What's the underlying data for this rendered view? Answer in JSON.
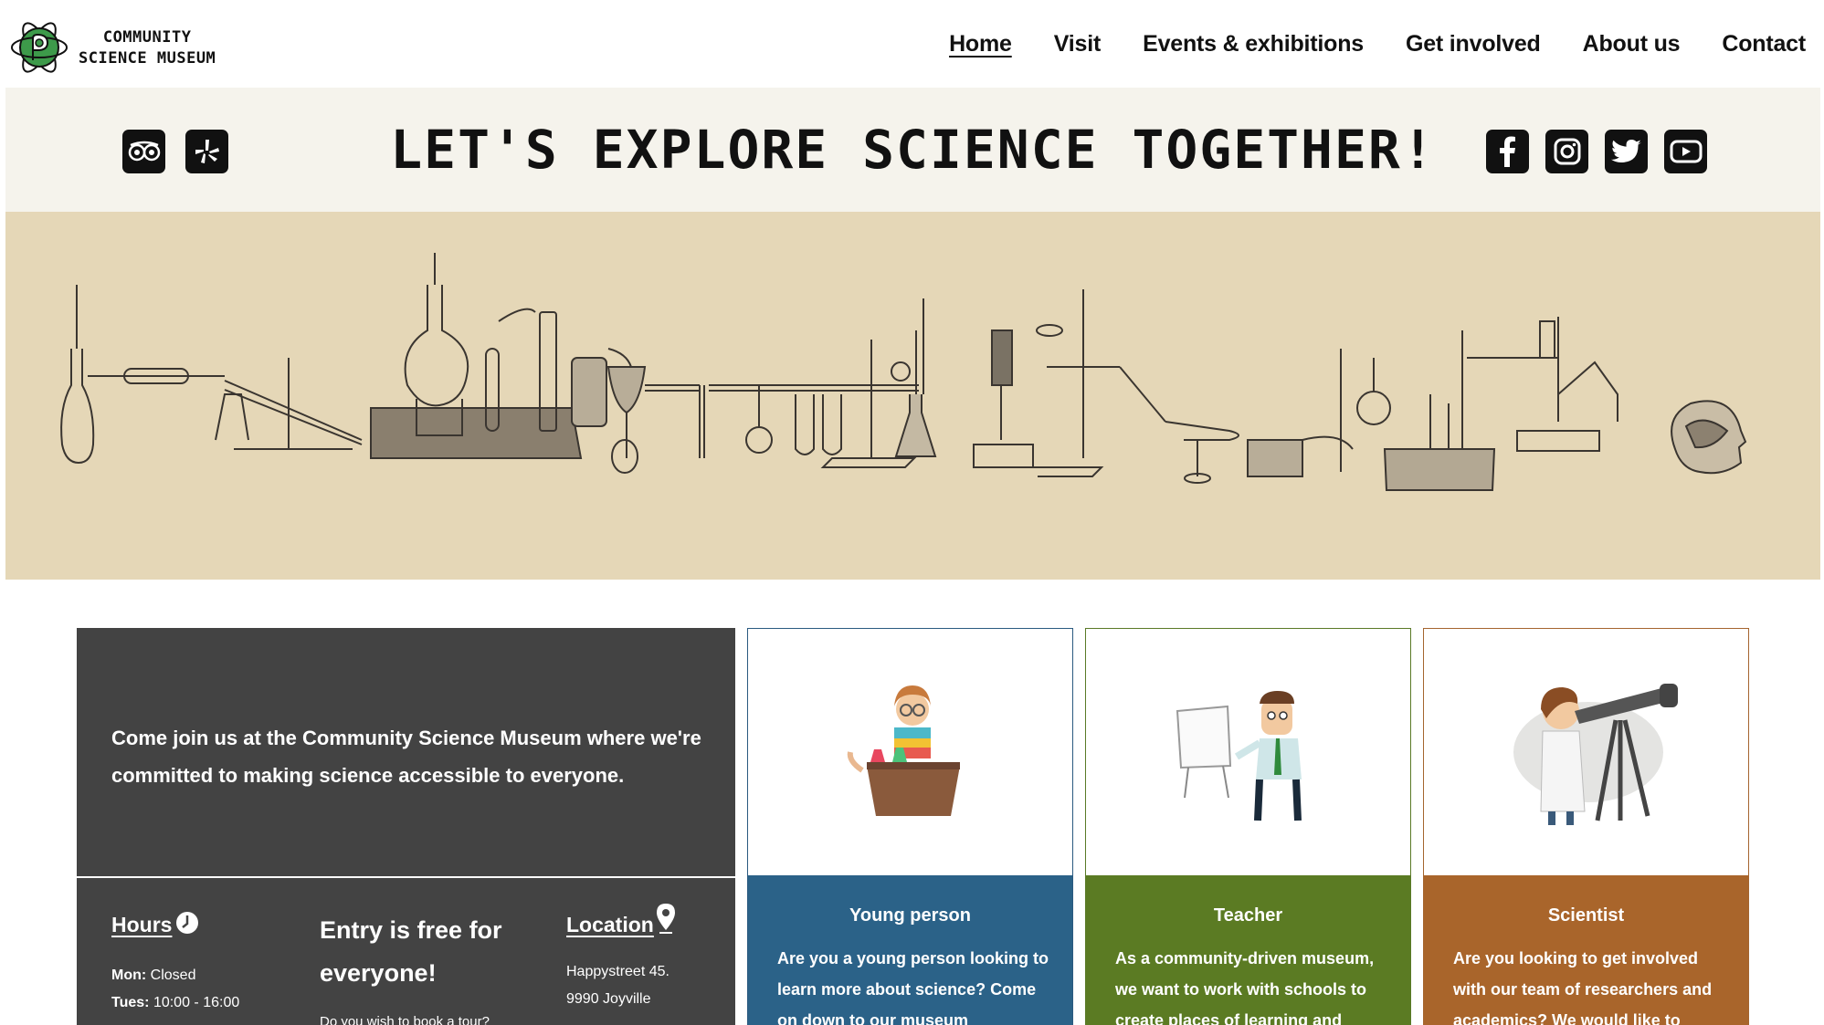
{
  "header": {
    "logo_line1": "COMMUNITY",
    "logo_line2": "SCIENCE MUSEUM",
    "nav": [
      {
        "label": "Home",
        "active": true
      },
      {
        "label": "Visit"
      },
      {
        "label": "Events & exhibitions"
      },
      {
        "label": "Get involved"
      },
      {
        "label": "About us"
      },
      {
        "label": "Contact"
      }
    ]
  },
  "banner": {
    "title": "LET'S EXPLORE SCIENCE TOGETHER!",
    "review_icons": [
      "tripadvisor-icon",
      "yelp-icon"
    ],
    "social_icons": [
      "facebook-icon",
      "instagram-icon",
      "twitter-icon",
      "youtube-icon"
    ]
  },
  "hero": {
    "image": "vintage laboratory apparatus illustration"
  },
  "intro": {
    "text": "Come join us at the Community Science Museum where we're committed to making science accessible to everyone."
  },
  "info": {
    "hours_title": "Hours",
    "hours": [
      {
        "day": "Mon:",
        "time": "Closed"
      },
      {
        "day": "Tues:",
        "time": "10:00 - 16:00"
      }
    ],
    "free_title": "Entry is free for everyone!",
    "tour_text": "Do you wish to book a tour?",
    "location_title": "Location",
    "address": [
      "Happystreet 45.",
      "9990 Joyville"
    ]
  },
  "cards": [
    {
      "title": "Young person",
      "text": "Are you a young person looking to learn more about science? Come on down to our museum",
      "color": "#2b6288"
    },
    {
      "title": "Teacher",
      "text": "As a community-driven museum, we want to work with schools to create places of learning and",
      "color": "#5b7b23"
    },
    {
      "title": "Scientist",
      "text": "Are you looking to get involved with our team of researchers and academics? We would like to",
      "color": "#a9652b"
    }
  ]
}
